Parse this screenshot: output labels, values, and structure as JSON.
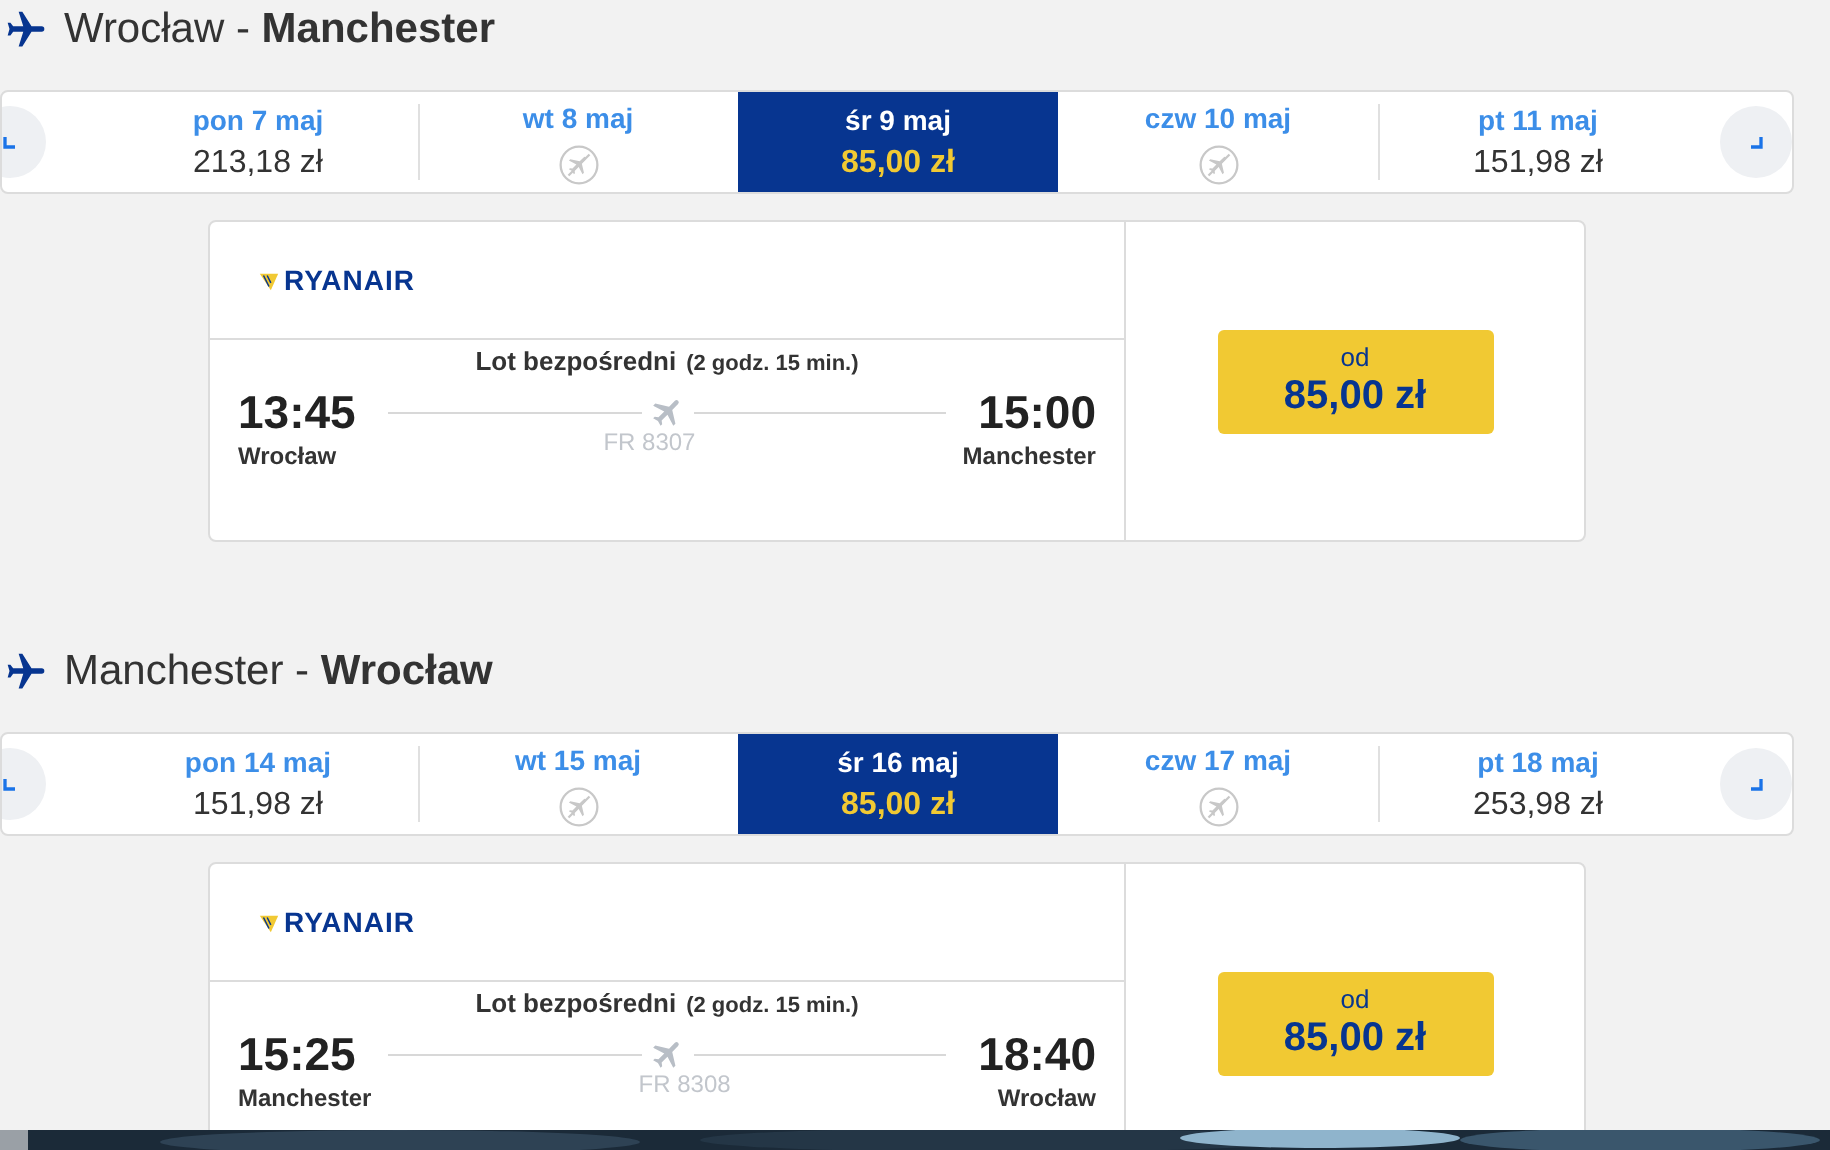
{
  "trips": [
    {
      "from": "Wrocław",
      "separator": "-",
      "to": "Manchester",
      "days": [
        {
          "date": "pon 7 maj",
          "price": "213,18 zł",
          "available": true,
          "selected": false
        },
        {
          "date": "wt 8 maj",
          "available": false,
          "selected": false
        },
        {
          "date": "śr 9 maj",
          "price": "85,00 zł",
          "available": true,
          "selected": true
        },
        {
          "date": "czw 10 maj",
          "available": false,
          "selected": false
        },
        {
          "date": "pt 11 maj",
          "price": "151,98 zł",
          "available": true,
          "selected": false
        }
      ],
      "flight": {
        "airline": "RYANAIR",
        "type": "Lot bezpośredni",
        "duration": "(2 godz. 15 min.)",
        "depart_time": "13:45",
        "depart_city": "Wrocław",
        "arrive_time": "15:00",
        "arrive_city": "Manchester",
        "number": "FR 8307",
        "price_label": "od",
        "price": "85,00 zł"
      }
    },
    {
      "from": "Manchester",
      "separator": "-",
      "to": "Wrocław",
      "days": [
        {
          "date": "pon 14 maj",
          "price": "151,98 zł",
          "available": true,
          "selected": false
        },
        {
          "date": "wt 15 maj",
          "available": false,
          "selected": false
        },
        {
          "date": "śr 16 maj",
          "price": "85,00 zł",
          "available": true,
          "selected": true
        },
        {
          "date": "czw 17 maj",
          "available": false,
          "selected": false
        },
        {
          "date": "pt 18 maj",
          "price": "253,98 zł",
          "available": true,
          "selected": false
        }
      ],
      "flight": {
        "airline": "RYANAIR",
        "type": "Lot bezpośredni",
        "duration": "(2 godz. 15 min.)",
        "depart_time": "15:25",
        "depart_city": "Manchester",
        "arrive_time": "18:40",
        "arrive_city": "Wrocław",
        "number": "FR 8308",
        "price_label": "od",
        "price": "85,00 zł"
      }
    }
  ]
}
